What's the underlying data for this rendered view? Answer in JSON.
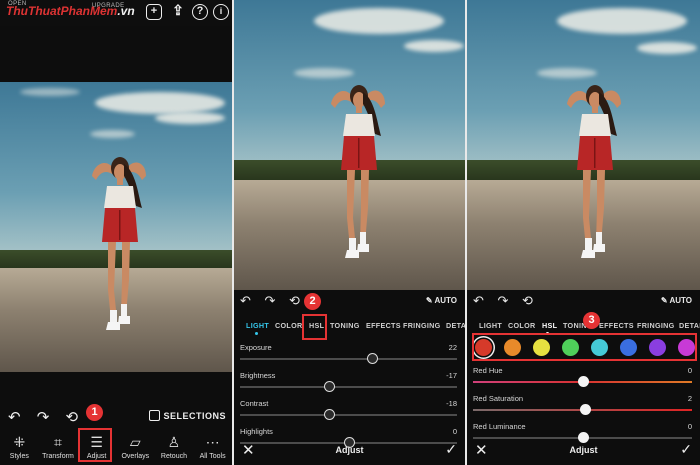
{
  "brand": {
    "logo_text": "ThuThuatPhanMem",
    "logo_suffix": ".vn"
  },
  "top_bar": {
    "open_label": "OPEN",
    "upgrade_label": "UPGRADE"
  },
  "panel1": {
    "undo_glyphs": "↶ ↷ ⟲",
    "selections_label": "SELECTIONS",
    "tools": [
      {
        "label": "Styles",
        "icon": "styles-icon"
      },
      {
        "label": "Transform",
        "icon": "crop-icon"
      },
      {
        "label": "Adjust",
        "icon": "sliders-icon"
      },
      {
        "label": "Overlays",
        "icon": "overlays-icon"
      },
      {
        "label": "Retouch",
        "icon": "person-icon"
      },
      {
        "label": "All Tools",
        "icon": "more-icon"
      }
    ]
  },
  "steps": {
    "one": "1",
    "two": "2",
    "three": "3"
  },
  "panel2": {
    "auto_label": "AUTO",
    "tabs": [
      "LIGHT",
      "COLOR",
      "HSL",
      "TONING",
      "EFFECTS",
      "FRINGING",
      "DETAIL"
    ],
    "sliders": [
      {
        "label": "Exposure",
        "value": "22",
        "level": 0.61
      },
      {
        "label": "Brightness",
        "value": "-17",
        "level": 0.41
      },
      {
        "label": "Contrast",
        "value": "-18",
        "level": 0.41
      },
      {
        "label": "Highlights",
        "value": "0",
        "level": 0.5
      }
    ],
    "footer_title": "Adjust"
  },
  "panel3": {
    "auto_label": "AUTO",
    "tabs": [
      "LIGHT",
      "COLOR",
      "HSL",
      "TONING",
      "EFFECTS",
      "FRINGING",
      "DETAIL"
    ],
    "swatches": [
      "#d63a2a",
      "#e88a2a",
      "#e6e040",
      "#4fcf5a",
      "#45c9d6",
      "#3a6ee0",
      "#8a3ee0",
      "#c83ad6"
    ],
    "sliders": [
      {
        "label": "Red Hue",
        "value": "0",
        "level": 0.5
      },
      {
        "label": "Red Saturation",
        "value": "2",
        "level": 0.51
      },
      {
        "label": "Red Luminance",
        "value": "0",
        "level": 0.5
      }
    ],
    "footer_title": "Adjust"
  },
  "colors": {
    "accent": "#35c6ea",
    "step_badge": "#e53334",
    "background": "#0d0d0d"
  }
}
